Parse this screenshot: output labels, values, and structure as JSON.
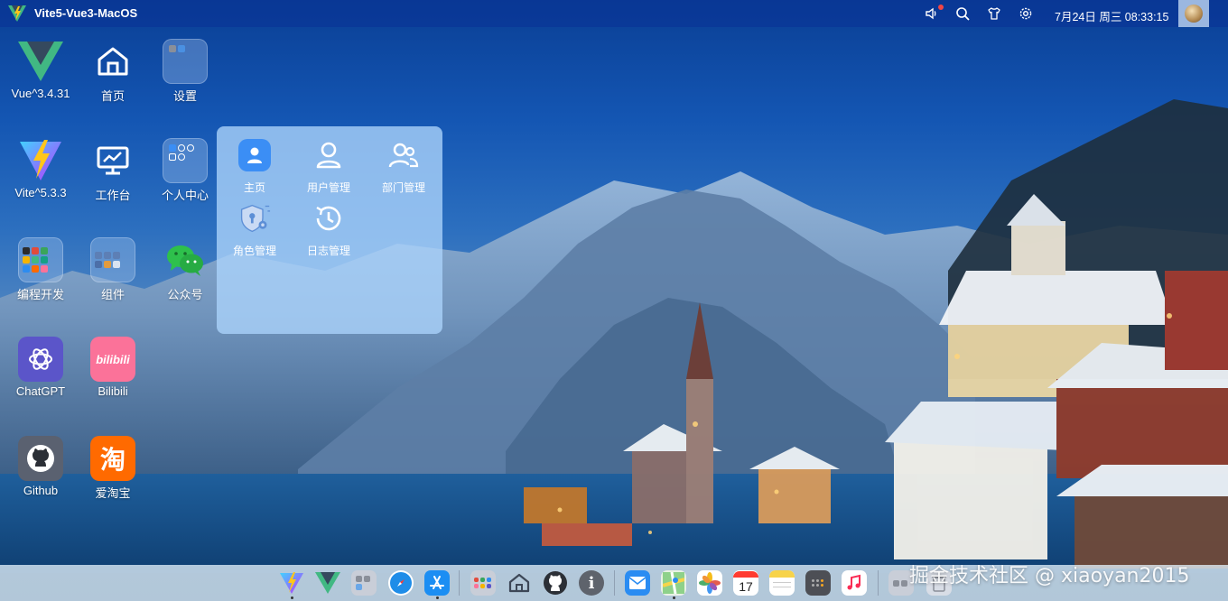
{
  "app": {
    "title": "Vite5-Vue3-MacOS"
  },
  "topbar": {
    "datetime": "7月24日 周三 08:33:15"
  },
  "desktop": {
    "icons": [
      {
        "label": "Vue^3.4.31"
      },
      {
        "label": "首页"
      },
      {
        "label": "设置"
      },
      {
        "label": "Vite^5.3.3"
      },
      {
        "label": "工作台"
      },
      {
        "label": "个人中心"
      },
      {
        "label": "编程开发"
      },
      {
        "label": "组件"
      },
      {
        "label": "公众号"
      },
      {
        "label": "ChatGPT"
      },
      {
        "label": "Bilibili"
      },
      {
        "label": "Github"
      },
      {
        "label": "爱淘宝"
      }
    ]
  },
  "folder_popup": {
    "items": [
      {
        "label": "主页"
      },
      {
        "label": "用户管理"
      },
      {
        "label": "部门管理"
      },
      {
        "label": "角色管理"
      },
      {
        "label": "日志管理"
      }
    ]
  },
  "icon_text": {
    "bilibili": "bilibili",
    "taobao": "淘",
    "calendar_day": "17",
    "info": "i"
  },
  "watermark": "掘金技术社区 @ xiaoyan2015",
  "colors": {
    "accent": "#3b8ef5",
    "vue_green": "#41b883",
    "vue_dark": "#35495e",
    "bilibili_pink": "#fb7299",
    "taobao_orange": "#ff6a00",
    "chatgpt_purple": "#5b55c9"
  }
}
